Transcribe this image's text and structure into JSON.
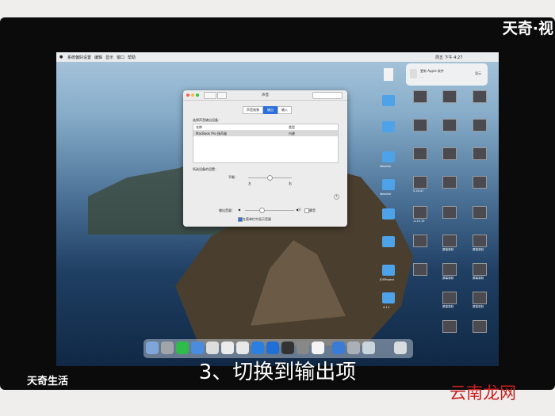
{
  "watermark_top": "天奇·视",
  "menubar": {
    "app": "系统偏好设置",
    "items": [
      "编辑",
      "显示",
      "窗口",
      "帮助"
    ],
    "clock": "周五 下午 4:27"
  },
  "notification": {
    "title": "更新 Apple 软件",
    "subtitle": "…",
    "action": "显示"
  },
  "desktop_labels": [
    "Weather",
    "Weather",
    "5.28.47",
    ".4.15.15",
    "JOSProject",
    "4.1.1",
    "屏幕录制",
    "屏幕录制",
    "屏幕录制",
    "屏幕录制",
    "屏幕录制",
    "屏幕录制"
  ],
  "window": {
    "title": "声音",
    "tabs": [
      "声音效果",
      "输出",
      "输入"
    ],
    "selected_tab": 1,
    "section_label": "选择声音输出设备：",
    "col_name": "名称",
    "col_type": "类型",
    "device_name": "MacBook Pro 扬声器",
    "device_type": "内建",
    "settings_label": "所选设备的设置：",
    "balance_label": "平衡：",
    "left": "左",
    "right": "右",
    "volume_label": "输出音量：",
    "mute_label": "静音",
    "menu_bar_label": "在菜单栏中显示音量",
    "help": "?"
  },
  "caption": "3、切换到输出项",
  "logo_bottom_left": "天奇生活",
  "logo_bottom_right": "云南龙网"
}
